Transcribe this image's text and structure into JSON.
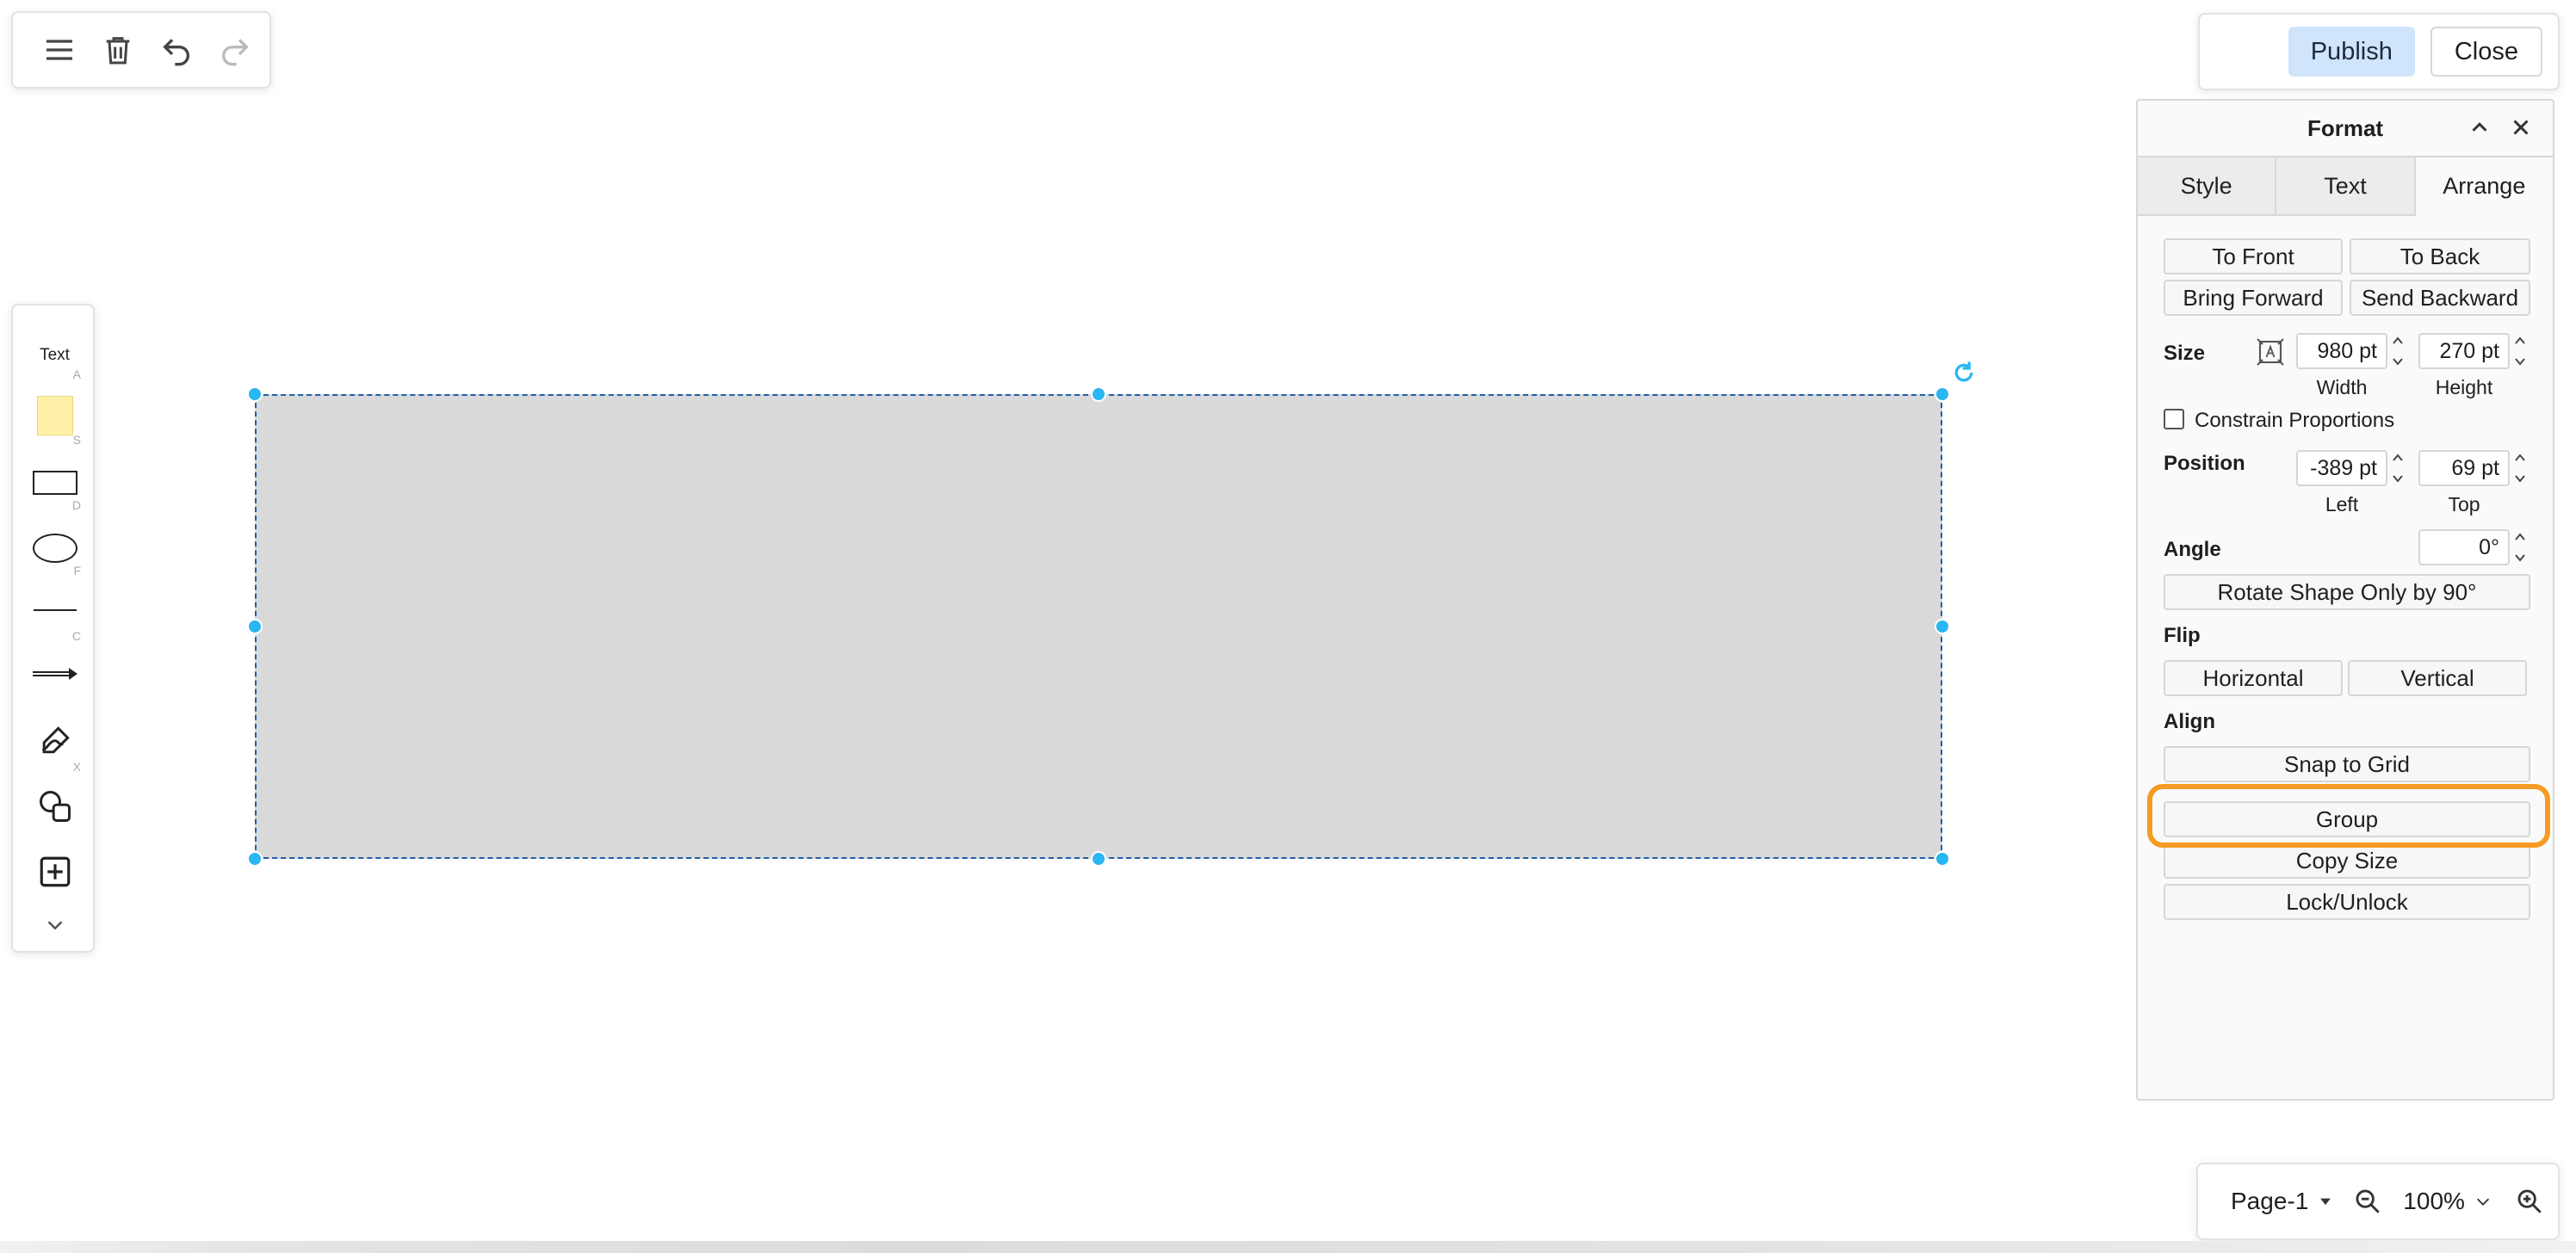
{
  "toolbar": {
    "icons": [
      "menu-icon",
      "trash-icon",
      "undo-icon",
      "redo-icon"
    ]
  },
  "header": {
    "publish_label": "Publish",
    "close_label": "Close"
  },
  "shapes": {
    "text_label": "Text",
    "keys": [
      "A",
      "S",
      "D",
      "F",
      "C",
      "X"
    ]
  },
  "format": {
    "title": "Format",
    "tabs": [
      "Style",
      "Text",
      "Arrange"
    ],
    "active_tab": "Arrange",
    "to_front": "To Front",
    "to_back": "To Back",
    "bring_forward": "Bring Forward",
    "send_backward": "Send Backward",
    "size_label": "Size",
    "width_value": "980 pt",
    "width_label": "Width",
    "height_value": "270 pt",
    "height_label": "Height",
    "constrain_label": "Constrain Proportions",
    "constrain_checked": false,
    "position_label": "Position",
    "left_value": "-389 pt",
    "left_label": "Left",
    "top_value": "69 pt",
    "top_label": "Top",
    "angle_label": "Angle",
    "angle_value": "0°",
    "rotate_label": "Rotate Shape Only by 90°",
    "flip_label": "Flip",
    "horizontal_label": "Horizontal",
    "vertical_label": "Vertical",
    "align_label": "Align",
    "snap_label": "Snap to Grid",
    "group_label": "Group",
    "copy_size_label": "Copy Size",
    "lock_label": "Lock/Unlock"
  },
  "footer": {
    "page_label": "Page-1",
    "zoom_label": "100%"
  },
  "colors": {
    "accent": "#29b6f2",
    "publish_bg": "#cfe5fb",
    "highlight": "#f59a23",
    "shape_fill": "#d9d9d9"
  }
}
